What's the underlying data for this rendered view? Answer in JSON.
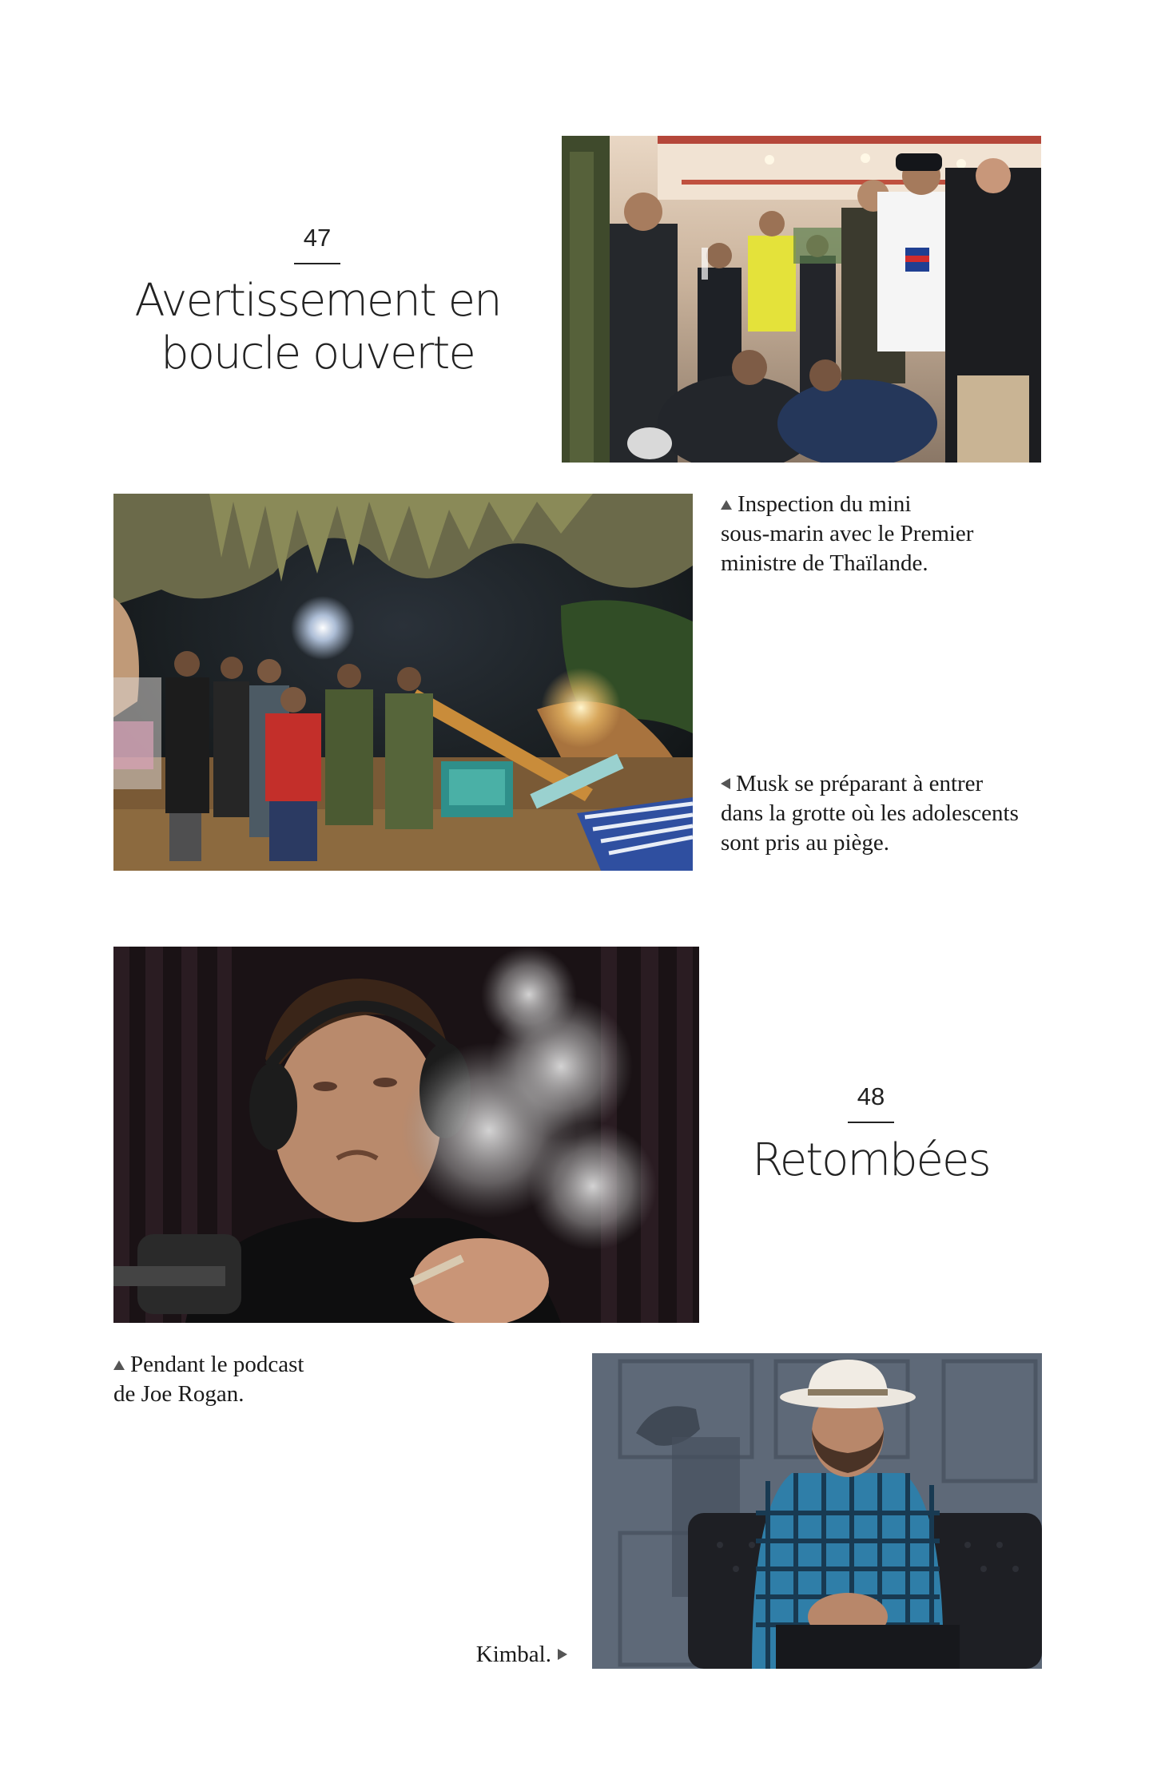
{
  "chapter_47": {
    "number": "47",
    "title_line1": "Avertissement en",
    "title_line2": "boucle ouverte"
  },
  "chapter_48": {
    "number": "48",
    "title": "Retombées"
  },
  "captions": {
    "submarine": {
      "line1": "Inspection du mini",
      "line2": "sous-marin avec le Premier",
      "line3": "ministre de Thaïlande."
    },
    "cave": {
      "line1": "Musk se préparant à entrer",
      "line2": "dans la grotte où les adolescents",
      "line3": "sont pris au piège."
    },
    "podcast": {
      "line1": "Pendant le podcast",
      "line2": "de Joe Rogan."
    },
    "kimbal": {
      "text": "Kimbal."
    }
  }
}
